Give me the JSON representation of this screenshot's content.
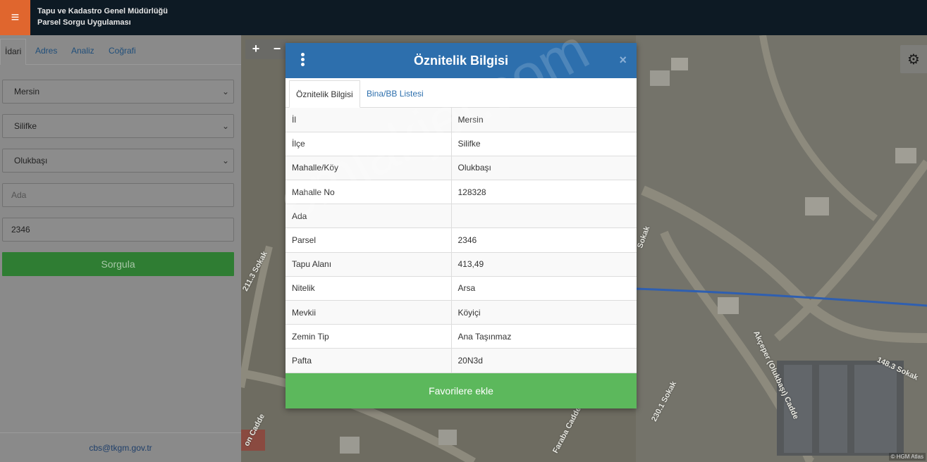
{
  "header": {
    "title_line1": "Tapu ve Kadastro Genel Müdürlüğü",
    "title_line2": "Parsel Sorgu Uygulaması",
    "menu_icon": "≡"
  },
  "left_panel": {
    "tabs": [
      {
        "label": "İdari"
      },
      {
        "label": "Adres"
      },
      {
        "label": "Analiz"
      },
      {
        "label": "Coğrafi"
      }
    ],
    "il": "Mersin",
    "ilce": "Silifke",
    "mahalle": "Olukbaşı",
    "ada_placeholder": "Ada",
    "parsel_value": "2346",
    "query_button": "Sorgula",
    "footer_email": "cbs@tkgm.gov.tr"
  },
  "map": {
    "zoom_in": "+",
    "zoom_out": "−",
    "settings_icon": "⚙",
    "attribution": "© HGM Atlas",
    "streets": [
      "211.3 Sokak",
      "Akçeper (Olukbaşı) Cadde",
      "148.3 Sokak",
      "230.1 Sokak",
      "Faraba Cadde",
      "Sokak",
      "on Cadde"
    ]
  },
  "dialog": {
    "title": "Öznitelik Bilgisi",
    "close": "×",
    "tabs": [
      {
        "label": "Öznitelik Bilgisi"
      },
      {
        "label": "Bina/BB Listesi"
      }
    ],
    "rows": [
      {
        "key": "İl",
        "value": "Mersin"
      },
      {
        "key": "İlçe",
        "value": "Silifke"
      },
      {
        "key": "Mahalle/Köy",
        "value": "Olukbaşı"
      },
      {
        "key": "Mahalle No",
        "value": "128328"
      },
      {
        "key": "Ada",
        "value": ""
      },
      {
        "key": "Parsel",
        "value": "2346"
      },
      {
        "key": "Tapu Alanı",
        "value": "413,49"
      },
      {
        "key": "Nitelik",
        "value": "Arsa"
      },
      {
        "key": "Mevkii",
        "value": "Köyiçi"
      },
      {
        "key": "Zemin Tip",
        "value": "Ana Taşınmaz"
      },
      {
        "key": "Pafta",
        "value": "20N3d"
      }
    ],
    "favorite_button": "Favorilere ekle"
  },
  "watermark": "emlakjet.com",
  "colors": {
    "header_bg": "#0d1a24",
    "menu_accent": "#e0662e",
    "dialog_header": "#2d6fad",
    "favorite_green": "#5cb85c",
    "query_green": "#2f7d33"
  }
}
